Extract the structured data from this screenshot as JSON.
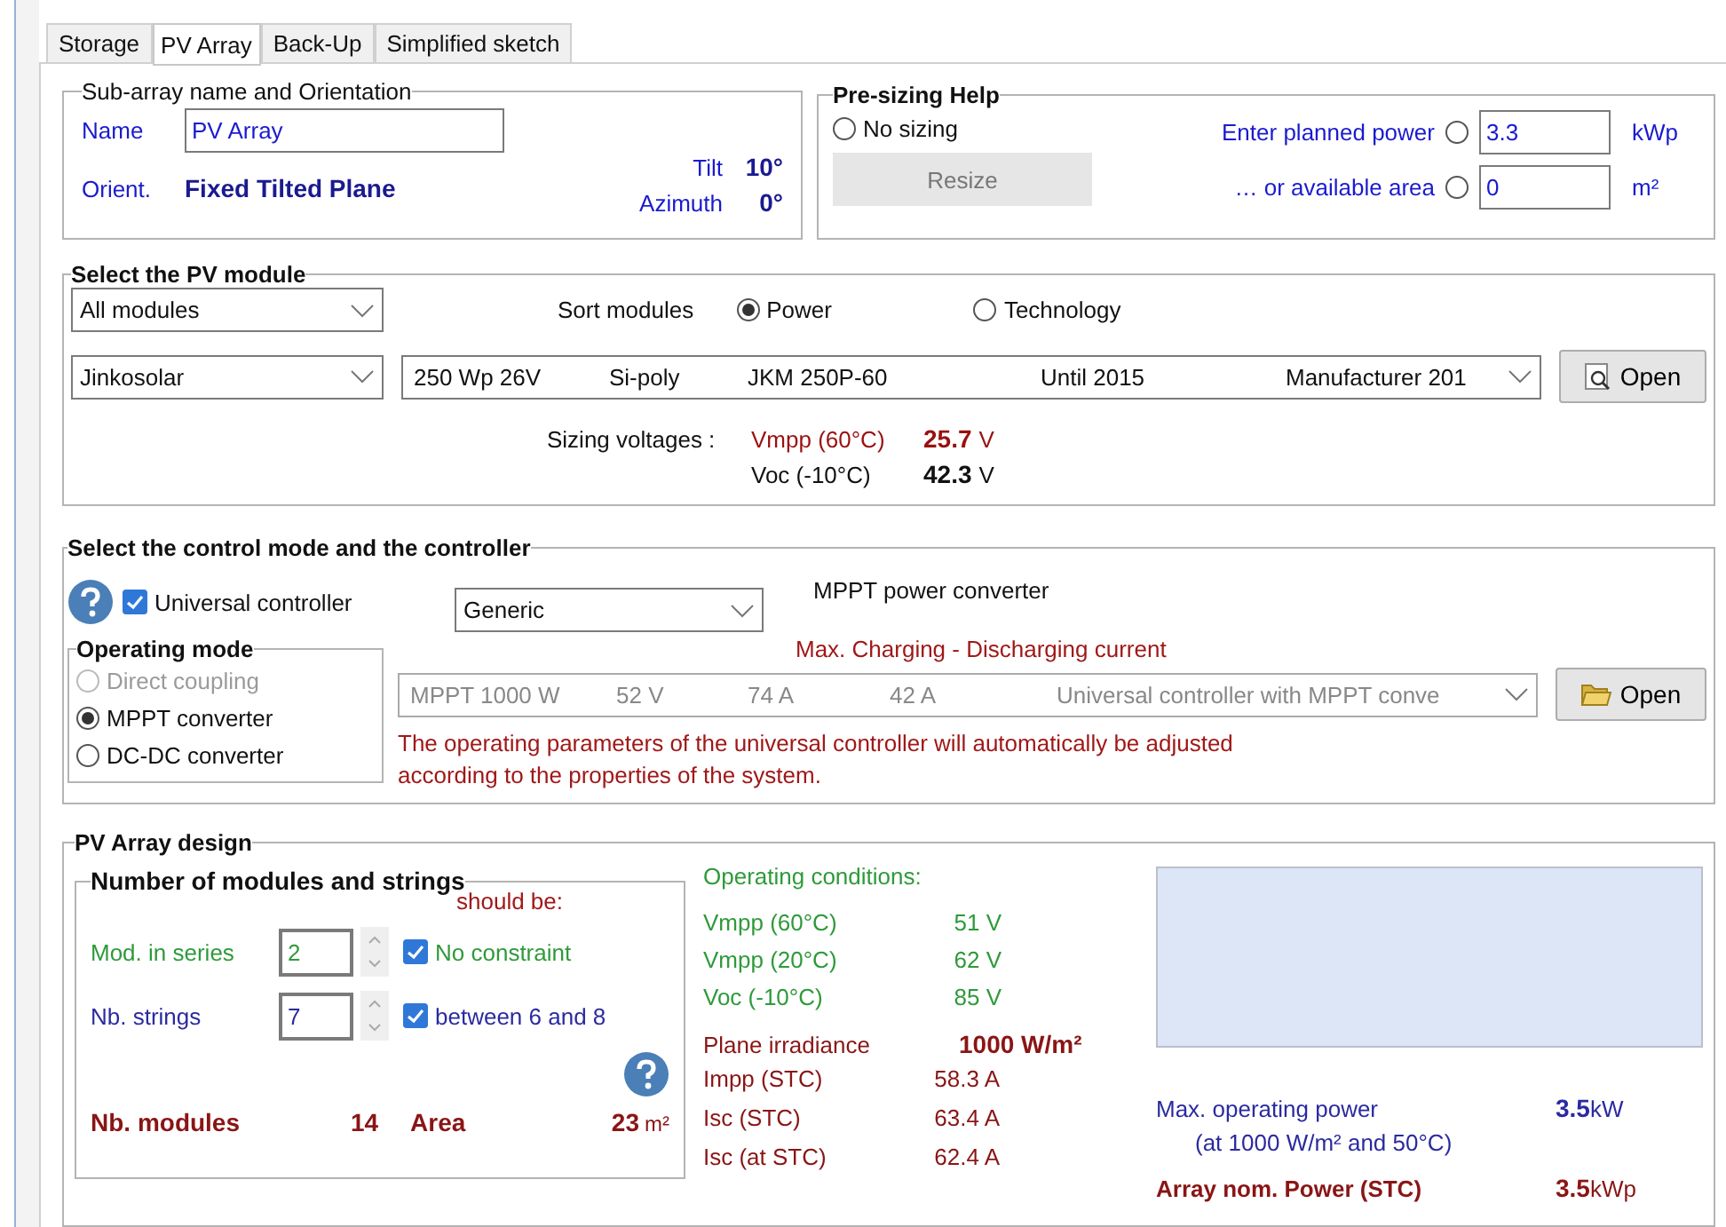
{
  "tabs": [
    {
      "label": "Storage",
      "selected": false
    },
    {
      "label": "PV Array",
      "selected": true
    },
    {
      "label": "Back-Up",
      "selected": false
    },
    {
      "label": "Simplified sketch",
      "selected": false
    }
  ],
  "orientation": {
    "title": "Sub-array name and Orientation",
    "name_label": "Name",
    "name_value": "PV Array",
    "orient_label": "Orient.",
    "orient_value": "Fixed Tilted Plane",
    "tilt_label": "Tilt",
    "tilt_value": "10°",
    "azimuth_label": "Azimuth",
    "azimuth_value": "0°"
  },
  "presizing": {
    "title": "Pre-sizing Help",
    "no_sizing": {
      "label": "No sizing",
      "selected": false
    },
    "resize_button": "Resize",
    "options": [
      {
        "label": "Enter planned power",
        "selected": false,
        "value": "3.3",
        "unit": "kWp"
      },
      {
        "label": "…  or available area",
        "selected": false,
        "value": "0",
        "unit": "m²"
      }
    ]
  },
  "module": {
    "title": "Select the PV module",
    "filter": "All modules",
    "sort_label": "Sort modules",
    "sort_options": [
      {
        "label": "Power",
        "selected": true
      },
      {
        "label": "Technology",
        "selected": false
      }
    ],
    "manufacturer": "Jinkosolar",
    "model_columns": [
      "250 Wp 26V",
      "Si-poly",
      "JKM 250P-60",
      "Until 2015",
      "Manufacturer 201"
    ],
    "open_button": "Open",
    "sizing_label": "Sizing voltages :",
    "voltages": [
      {
        "label": "Vmpp (60°C)",
        "value": "25.7",
        "unit": "V",
        "kind": "warning"
      },
      {
        "label": "Voc (-10°C)",
        "value": "42.3",
        "unit": "V",
        "kind": "normal"
      }
    ]
  },
  "controller": {
    "title": "Select the control mode and the controller",
    "universal": {
      "label": "Universal controller",
      "checked": true
    },
    "type": "Generic",
    "converter_label": "MPPT power converter",
    "current_label": "Max. Charging - Discharging current",
    "mode_title": "Operating mode",
    "modes": [
      {
        "label": "Direct coupling",
        "selected": false,
        "disabled": true
      },
      {
        "label": "MPPT converter",
        "selected": true,
        "disabled": false
      },
      {
        "label": "DC-DC converter",
        "selected": false,
        "disabled": false
      }
    ],
    "model_columns": [
      "MPPT 1000 W",
      "52 V",
      "74 A",
      "42 A",
      "Universal controller with MPPT conve"
    ],
    "model_disabled": true,
    "open_button": "Open",
    "note": "The operating parameters of the universal controller will automatically be adjusted according to the properties of the system."
  },
  "design": {
    "title": "PV Array design",
    "strings": {
      "title": "Number of modules and strings",
      "should_be": "should be:",
      "rows": [
        {
          "label": "Mod. in series",
          "value": "2",
          "constraint": "No constraint",
          "checked": true,
          "color": "#2e9a3a"
        },
        {
          "label": "Nb. strings",
          "value": "7",
          "constraint": "between 6 and 8",
          "checked": true,
          "color": "#2a2aa0"
        }
      ],
      "modules_label": "Nb. modules",
      "modules_value": "14",
      "area_label": "Area",
      "area_value": "23",
      "area_unit": "m²"
    },
    "conditions_title": "Operating conditions:",
    "conditions": [
      {
        "label": "Vmpp (60°C)",
        "value": "51 V"
      },
      {
        "label": "Vmpp (20°C)",
        "value": "62 V"
      },
      {
        "label": "Voc (-10°C)",
        "value": "85 V"
      }
    ],
    "irradiance_label": "Plane irradiance",
    "irradiance_value": "1000  W/m²",
    "currents": [
      {
        "label": "Impp (STC)",
        "value": "58.3 A"
      },
      {
        "label": "Isc (STC)",
        "value": "63.4 A"
      },
      {
        "label": "Isc (at STC)",
        "value": "62.4 A"
      }
    ],
    "max_power": {
      "label": "Max. operating power",
      "sublabel": "(at 1000 W/m²  and 50°C)",
      "value": "3.5",
      "unit": "kW"
    },
    "nominal_power": {
      "label": "Array nom. Power (STC)",
      "value": "3.5",
      "unit": "kWp"
    }
  }
}
